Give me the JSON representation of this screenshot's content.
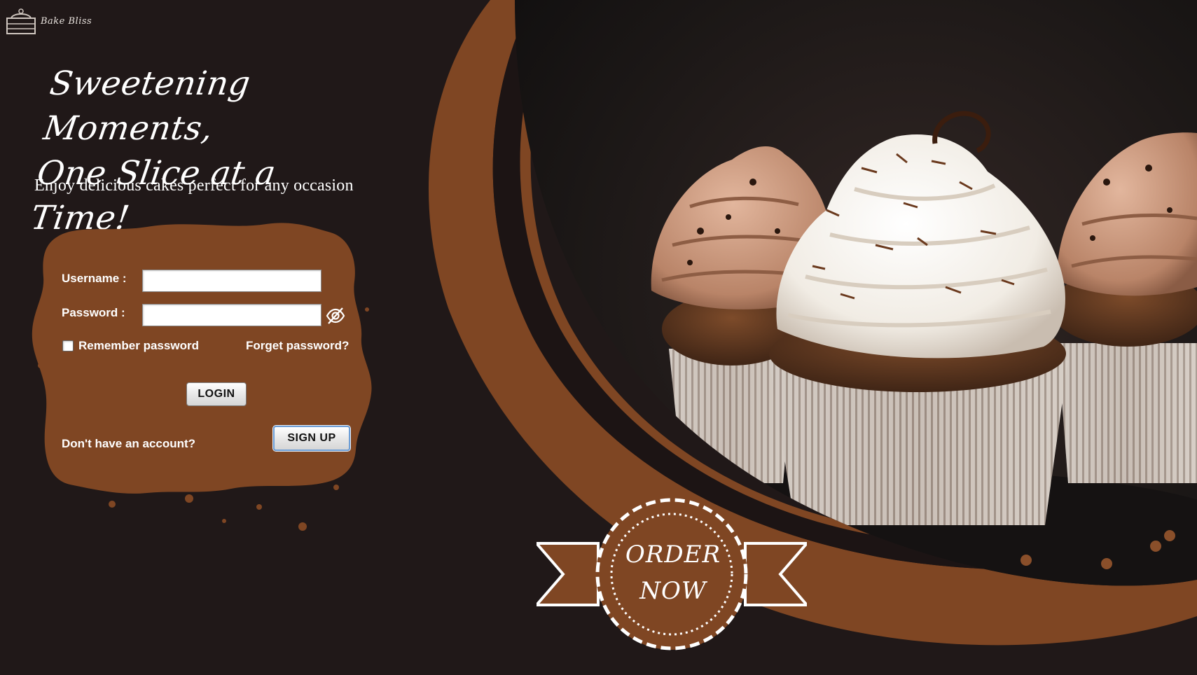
{
  "brand": {
    "name": "Bake Bliss"
  },
  "hero": {
    "headline_line1": "Sweetening Moments,",
    "headline_line2": "One Slice at a Time!",
    "tagline": "Enjoy delicious cakes perfect for any occasion"
  },
  "login_form": {
    "username_label": "Username :",
    "username_value": "",
    "password_label": "Password :",
    "password_value": "",
    "remember_label": "Remember password",
    "remember_checked": false,
    "forgot_label": "Forget password?",
    "login_button": "LOGIN",
    "signup_prompt": "Don't have an account?",
    "signup_button": "SIGN UP"
  },
  "order_badge": {
    "line1": "ORDER",
    "line2": "NOW"
  },
  "icons": {
    "logo": "cake-icon",
    "password_toggle": "eye-off-icon"
  },
  "colors": {
    "background": "#201818",
    "accent_brown": "#7f4623",
    "text_white": "#ffffff"
  }
}
